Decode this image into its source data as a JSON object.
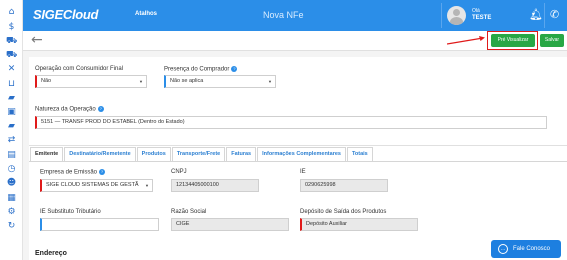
{
  "sidebar": {
    "icons": [
      "home-icon",
      "dollar-icon",
      "cart-icon",
      "cart-icon",
      "tools-icon",
      "basket-icon",
      "truck-icon",
      "box-icon",
      "truck-icon",
      "transfer-icon",
      "chart-icon",
      "clock-icon",
      "users-icon",
      "document-icon",
      "gear-icon",
      "sync-icon"
    ]
  },
  "topbar": {
    "logo": "SIGECloud",
    "atalhos": "Atalhos",
    "page_title": "Nova NFe",
    "greeting": "Olá",
    "username": "TESTE",
    "color": "#2b8ee8"
  },
  "toolbar": {
    "pre_visualizar": "Pré Visualizar",
    "salvar": "Salvar"
  },
  "form": {
    "consumidor_final": {
      "label": "Operação com Consumidor Final",
      "value": "Não"
    },
    "presenca_comprador": {
      "label": "Presença do Comprador",
      "value": "Não se aplica"
    },
    "natureza_operacao": {
      "label": "Natureza da Operação",
      "value": "5151 — TRANSF PROD DO ESTABEL (Dentro do Estado)"
    }
  },
  "tabs": [
    "Emitente",
    "Destinatário/Remetente",
    "Produtos",
    "Transporte/Frete",
    "Faturas",
    "Informações Complementares",
    "Totais"
  ],
  "emitente": {
    "empresa": {
      "label": "Empresa de Emissão",
      "value": "SIGE CLOUD SISTEMAS DE GESTÃ"
    },
    "cnpj": {
      "label": "CNPJ",
      "value": "12134405000100"
    },
    "ie": {
      "label": "IE",
      "value": "0290625998"
    },
    "ie_substituto": {
      "label": "IE Substituto Tributário",
      "value": ""
    },
    "razao_social": {
      "label": "Razão Social",
      "value": "CIGE"
    },
    "deposito": {
      "label": "Depósito de Saída dos Produtos",
      "value": "Depósito Auxiliar"
    }
  },
  "endereco_title": "Endereço",
  "fale_conosco": "Fale Conosco"
}
